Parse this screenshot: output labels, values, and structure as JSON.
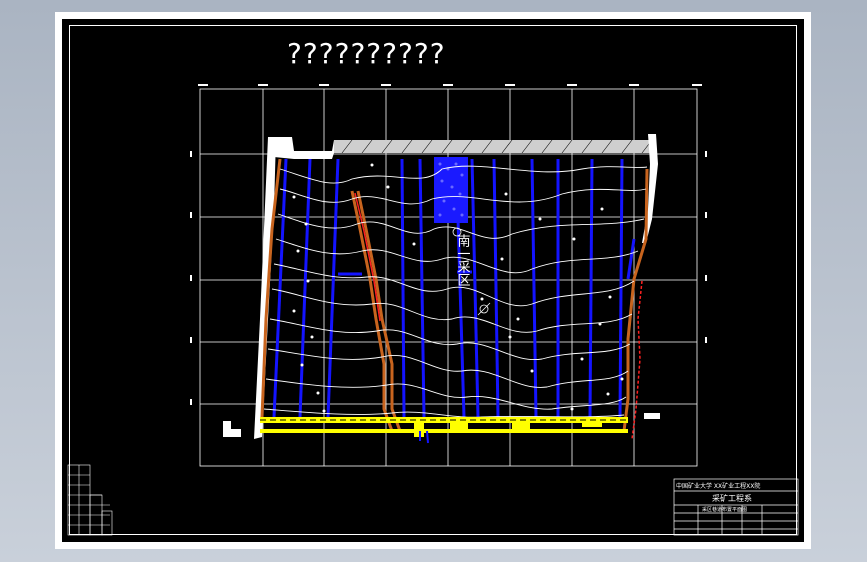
{
  "drawing": {
    "title": "??????????",
    "area_label": "南一采区"
  },
  "title_block": {
    "company": "中国矿业大学 XX矿业工程XX院",
    "drawing_name": "采矿工程系",
    "sub_caption": "采区巷道布置平面图"
  },
  "colors": {
    "background": "#000000",
    "grid": "#ffffff",
    "contour": "#ffffff",
    "roadway_blue": "#1010ff",
    "boundary_orange": "#c8641e",
    "main_roadway_yellow": "#ffff00",
    "fault_red": "#ff2020"
  }
}
